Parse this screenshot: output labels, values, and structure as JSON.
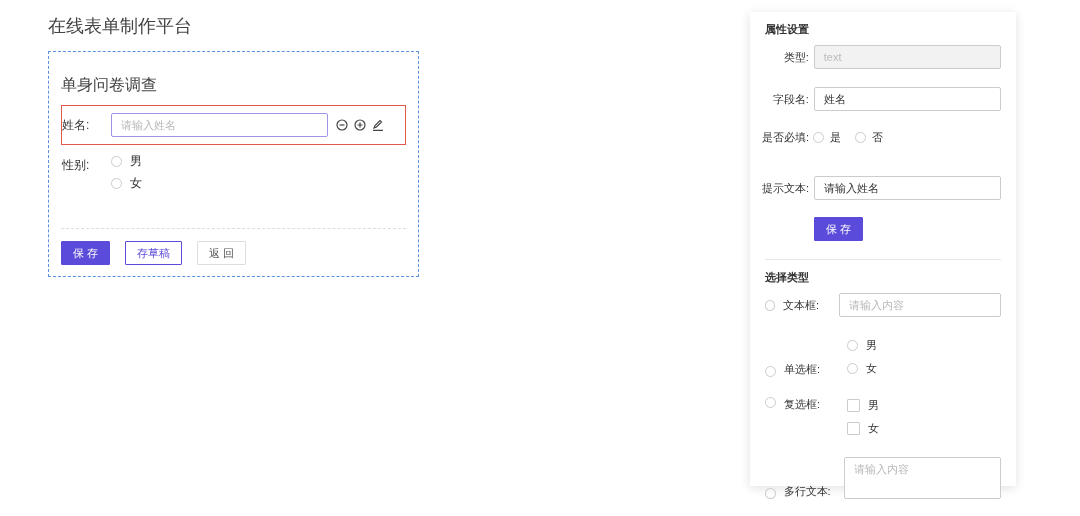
{
  "page_title": "在线表单制作平台",
  "form": {
    "title": "单身问卷调查",
    "fields": [
      {
        "kind": "text",
        "label": "姓名:",
        "placeholder": "请输入姓名",
        "selected": true
      },
      {
        "kind": "radio",
        "label": "性别:",
        "options": [
          {
            "label": "男",
            "checked": false
          },
          {
            "label": "女",
            "checked": false
          }
        ],
        "selected": false
      }
    ],
    "buttons": [
      {
        "label": "保 存",
        "kind": "primary"
      },
      {
        "label": "存草稿",
        "kind": "outline"
      },
      {
        "label": "返 回",
        "kind": "default"
      }
    ]
  },
  "properties": {
    "title": "属性设置",
    "type": {
      "label": "类型:",
      "value": "text",
      "disabled": true
    },
    "field_name": {
      "label": "字段名:",
      "value": "姓名"
    },
    "required": {
      "label": "是否必填:",
      "options": [
        {
          "label": "是",
          "selected": false
        },
        {
          "label": "否",
          "selected": false
        }
      ]
    },
    "hint": {
      "label": "提示文本:",
      "value": "请输入姓名"
    },
    "save_button": "保 存"
  },
  "types": {
    "title": "选择类型",
    "items": [
      {
        "kind": "text",
        "label": "文本框:",
        "selected": false,
        "placeholder": "请输入内容"
      },
      {
        "kind": "radio",
        "label": "单选框:",
        "selected": false,
        "options": [
          {
            "label": "男",
            "checked": false
          },
          {
            "label": "女",
            "checked": false
          }
        ]
      },
      {
        "kind": "checkbox",
        "label": "复选框:",
        "selected": false,
        "options": [
          {
            "label": "男",
            "checked": false
          },
          {
            "label": "女",
            "checked": false
          }
        ]
      },
      {
        "kind": "textarea",
        "label": "多行文本:",
        "selected": false,
        "placeholder": "请输入内容"
      }
    ]
  }
}
